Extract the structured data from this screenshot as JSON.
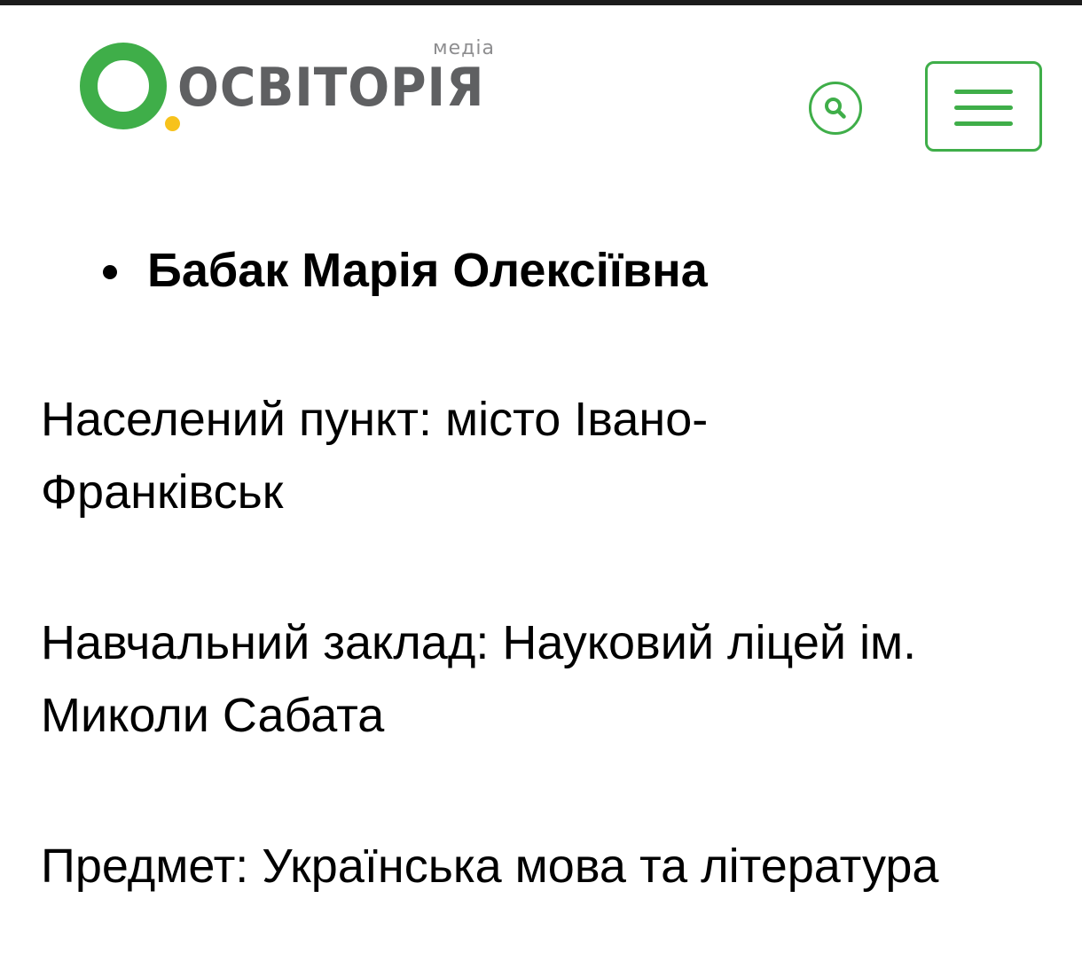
{
  "header": {
    "logo": {
      "wordmark": "ОСВІТОРІЯ",
      "suffix": "медіа"
    },
    "search_icon": "search-icon",
    "menu_icon": "hamburger-menu-icon",
    "colors": {
      "accent_green": "#3fae49",
      "logo_dot_yellow": "#f7c21c",
      "logo_text_gray": "#5f6062",
      "top_bar": "#1c1c1c"
    }
  },
  "article": {
    "name": "Бабак Марія Олексіївна",
    "settlement": "Населений пункт: місто Івано-Франківськ",
    "school": "Навчальний заклад: Науковий ліцей ім. Миколи Сабата",
    "subject": "Предмет: Українська мова та література"
  }
}
